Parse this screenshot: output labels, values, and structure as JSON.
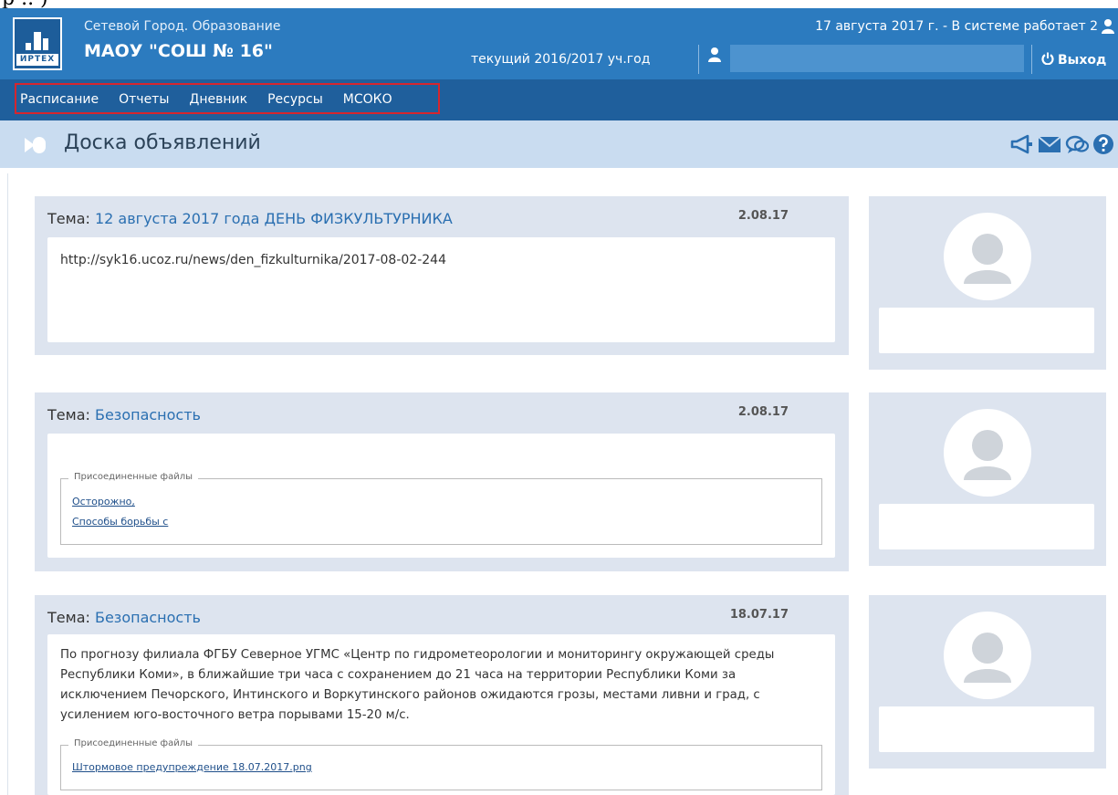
{
  "header": {
    "app_name": "Сетевой Город. Образование",
    "school_name": "МАОУ \"СОШ № 16\"",
    "logo_text": "ИРТЕХ",
    "academic_year": "текущий 2016/2017 уч.год",
    "status": "17 августа 2017 г. - В системе работает 2",
    "logout_label": "Выход",
    "colors": {
      "header_bg": "#2c7bbf",
      "nav_bg": "#1f5f9c",
      "title_bg": "#c9dcf0",
      "highlight": "#d6262e"
    }
  },
  "nav": {
    "items": [
      {
        "label": "Расписание"
      },
      {
        "label": "Отчеты"
      },
      {
        "label": "Дневник"
      },
      {
        "label": "Ресурсы"
      },
      {
        "label": "МСОКО"
      }
    ]
  },
  "page": {
    "title": "Доска объявлений",
    "toolbar_icons": [
      "megaphone-icon",
      "mail-icon",
      "chat-icon",
      "help-icon"
    ]
  },
  "announcements": [
    {
      "topic_label": "Тема:",
      "topic": "12 августа 2017 года ДЕНЬ ФИЗКУЛЬТУРНИКА",
      "date": "2.08.17",
      "text": "http://syk16.ucoz.ru/news/den_fizkulturnika/2017-08-02-244"
    },
    {
      "topic_label": "Тема:",
      "topic": "Безопасность",
      "date": "2.08.17",
      "files_label": "Присоединенные файлы",
      "files": [
        "Осторожно,",
        "Способы борьбы с"
      ]
    },
    {
      "topic_label": "Тема:",
      "topic": "Безопасность",
      "date": "18.07.17",
      "text": "По прогнозу филиала ФГБУ Северное УГМС «Центр по гидрометеорологии и мониторингу окружающей среды Республики Коми», в ближайшие три часа с сохранением до 21 часа на территории Республики Коми за исключением Печорского, Интинского и Воркутинского районов ожидаются грозы, местами ливни и град, с усилением юго-восточного ветра порывами 15-20 м/с.",
      "files_label": "Присоединенные файлы",
      "files": [
        "Штормовое предупреждение 18.07.2017.png"
      ]
    }
  ]
}
